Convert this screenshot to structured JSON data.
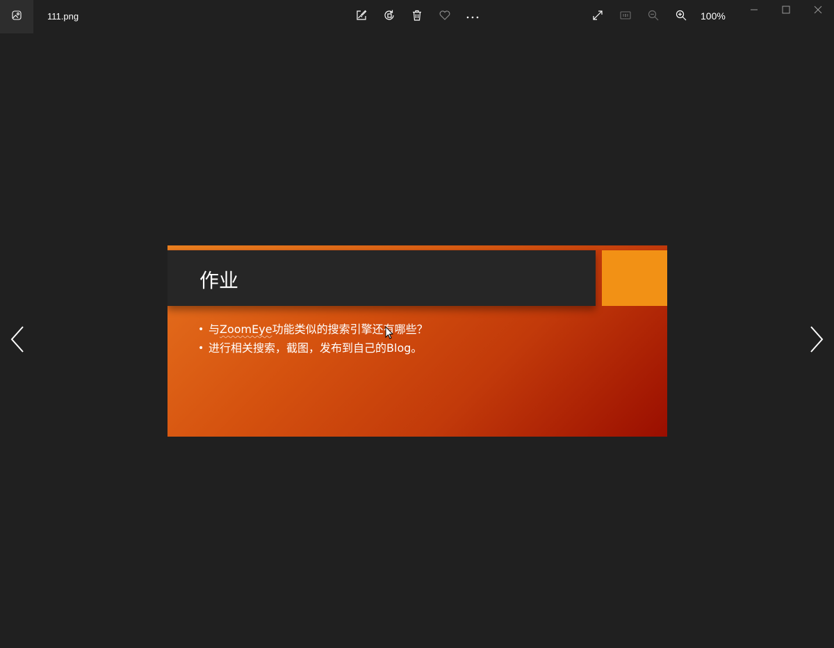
{
  "window": {
    "filename": "111.png",
    "zoom": "100%"
  },
  "toolbar": {
    "icons": [
      "edit-image-icon",
      "rotate-icon",
      "delete-icon",
      "favorite-icon",
      "more-icon"
    ],
    "right_icons": [
      "fullscreen-icon",
      "actual-size-icon",
      "zoom-out-icon",
      "zoom-in-icon"
    ]
  },
  "window_controls": [
    "minimize-icon",
    "maximize-icon",
    "close-icon"
  ],
  "slide": {
    "title": "作业",
    "bullet1_before": "与",
    "bullet1_term": "ZoomEye",
    "bullet1_after": "功能类似的搜索引擎还有哪些？",
    "bullet2_before": "进行相关搜索，截图，发布到自己的",
    "bullet2_term": "Blog",
    "bullet2_after": "。",
    "colors": {
      "gradient_start": "#e6711e",
      "gradient_end": "#9a0e00",
      "title_box": "#262626",
      "accent": "#f29115"
    }
  },
  "colors": {
    "background": "#202020",
    "foreground": "#ffffff"
  }
}
